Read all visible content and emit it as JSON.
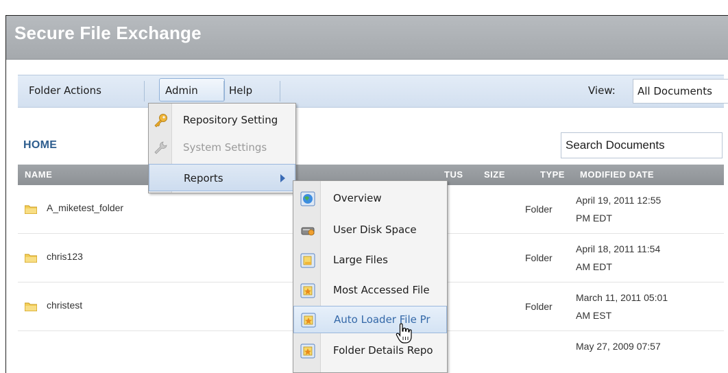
{
  "app": {
    "title": "Secure File Exchange"
  },
  "toolbar": {
    "folder_actions": "Folder Actions",
    "admin": "Admin",
    "help": "Help",
    "view_label": "View:",
    "view_value": "All Documents"
  },
  "breadcrumb": {
    "home": "HOME"
  },
  "search": {
    "placeholder": "Search Documents"
  },
  "table": {
    "columns": [
      "NAME",
      "TUS",
      "SIZE",
      "TYPE",
      "MODIFIED DATE"
    ],
    "rows": [
      {
        "name": "A_miketest_folder",
        "type": "Folder",
        "date_line1": "April 19, 2011 12:55",
        "date_line2": "PM EDT"
      },
      {
        "name": "chris123",
        "type": "Folder",
        "date_line1": "April 18, 2011 11:54",
        "date_line2": "AM EDT"
      },
      {
        "name": "christest",
        "type": "Folder",
        "date_line1": "March 11, 2011 05:01",
        "date_line2": "AM EST"
      },
      {
        "name": "",
        "type": "",
        "date_line1": "May 27, 2009 07:57",
        "date_line2": ""
      }
    ]
  },
  "admin_menu": {
    "items": [
      {
        "label": "Repository Setting",
        "icon": "key-icon",
        "enabled": true
      },
      {
        "label": "System Settings",
        "icon": "wrench-icon",
        "enabled": false
      },
      {
        "label": "Reports",
        "icon": "",
        "enabled": true,
        "submenu": true
      }
    ]
  },
  "reports_menu": {
    "items": [
      {
        "label": "Overview",
        "icon": "globe-icon"
      },
      {
        "label": "User Disk Space",
        "icon": "disk-icon"
      },
      {
        "label": "Large Files",
        "icon": "report-icon"
      },
      {
        "label": "Most Accessed File",
        "icon": "report-star-icon"
      },
      {
        "label": "Auto Loader File Pr",
        "icon": "report-star-icon"
      },
      {
        "label": "Folder Details Repo",
        "icon": "report-star-icon"
      }
    ]
  },
  "colors": {
    "accent": "#2d5d8e",
    "toolbar": "#d9e5f3",
    "header": "#9a9ea2",
    "hover_text": "#3468a8"
  }
}
